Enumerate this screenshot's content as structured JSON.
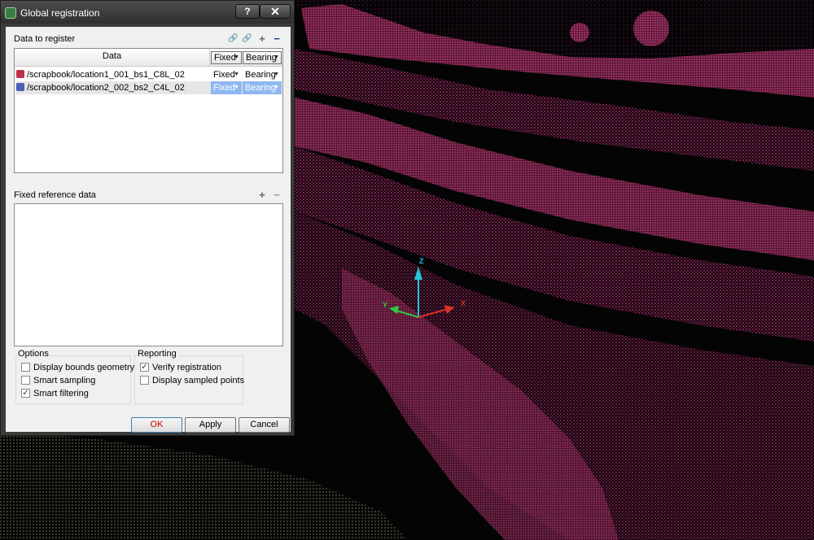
{
  "window": {
    "title": "Global registration",
    "help_label": "?",
    "close_label": "✕"
  },
  "data_section": {
    "label": "Data to register",
    "header": {
      "data": "Data",
      "fixed": "Fixed",
      "bearing": "Bearing"
    },
    "rows": [
      {
        "name": "/scrapbook/location1_001_bs1_C8L_02",
        "fixed": "Fixed",
        "bearing": "Bearing",
        "selected": false,
        "icon_color": "#c0304b"
      },
      {
        "name": "/scrapbook/location2_002_bs2_C4L_02",
        "fixed": "Fixed",
        "bearing": "Bearing",
        "selected": true,
        "icon_color": "#4a5fb8"
      }
    ]
  },
  "reference_section": {
    "label": "Fixed reference data"
  },
  "options": {
    "title": "Options",
    "items": [
      {
        "label": "Display bounds geometry",
        "checked": false
      },
      {
        "label": "Smart sampling",
        "checked": false
      },
      {
        "label": "Smart filtering",
        "checked": true
      }
    ]
  },
  "reporting": {
    "title": "Reporting",
    "items": [
      {
        "label": "Verify registration",
        "checked": true
      },
      {
        "label": "Display sampled points",
        "checked": false
      }
    ]
  },
  "buttons": {
    "ok": "OK",
    "apply": "Apply",
    "cancel": "Cancel"
  },
  "axes": {
    "z": "Z",
    "y": "Y",
    "x": "X"
  },
  "colors": {
    "point_cloud_primary": "#c2356f",
    "point_cloud_secondary": "#8e8a6a",
    "selection": "#8fb8f0",
    "ok_text": "#d10000"
  }
}
